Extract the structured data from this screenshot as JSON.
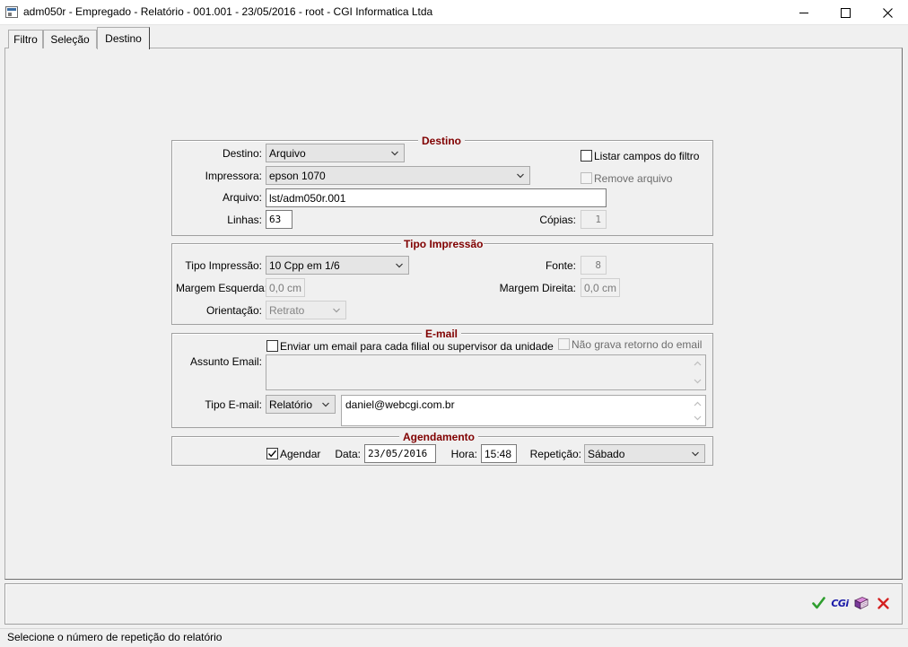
{
  "window": {
    "title": "adm050r - Empregado - Relatório - 001.001 - 23/05/2016 - root - CGI Informatica Ltda"
  },
  "tabs": [
    {
      "label": "Filtro"
    },
    {
      "label": "Seleção"
    },
    {
      "label": "Destino",
      "active": true
    }
  ],
  "destino": {
    "title": "Destino",
    "destino_label": "Destino:",
    "destino_value": "Arquivo",
    "impressora_label": "Impressora:",
    "impressora_value": "epson 1070",
    "arquivo_label": "Arquivo:",
    "arquivo_value": "lst/adm050r.001",
    "linhas_label": "Linhas:",
    "linhas_value": "63",
    "listar_label": "Listar campos do filtro",
    "listar_checked": false,
    "remove_label": "Remove arquivo",
    "remove_checked": false,
    "copias_label": "Cópias:",
    "copias_value": "1"
  },
  "tipo_impressao": {
    "title": "Tipo Impressão",
    "tipo_label": "Tipo Impressão:",
    "tipo_value": "10 Cpp em 1/6",
    "margem_esq_label": "Margem Esquerda:",
    "margem_esq_value": "0,0 cm",
    "orientacao_label": "Orientação:",
    "orientacao_value": "Retrato",
    "fonte_label": "Fonte:",
    "fonte_value": "8",
    "margem_dir_label": "Margem Direita:",
    "margem_dir_value": "0,0 cm"
  },
  "email": {
    "title": "E-mail",
    "enviar_label": "Enviar um email para cada filial ou supervisor da unidade",
    "enviar_checked": false,
    "nao_grava_label": "Não grava retorno do email",
    "nao_grava_checked": false,
    "assunto_label": "Assunto Email:",
    "assunto_value": "",
    "tipo_label": "Tipo E-mail:",
    "tipo_value": "Relatório",
    "destinatario_value": "daniel@webcgi.com.br"
  },
  "agendamento": {
    "title": "Agendamento",
    "agendar_label": "Agendar",
    "agendar_checked": true,
    "data_label": "Data:",
    "data_value": "23/05/2016",
    "hora_label": "Hora:",
    "hora_value": "15:48",
    "repeticao_label": "Repetição:",
    "repeticao_value": "Sábado"
  },
  "toolbar": {
    "confirm_icon": "checkmark-icon",
    "cgi_label": "CGi",
    "book_icon": "book-icon",
    "cancel_icon": "close-x-icon",
    "colors": {
      "confirm": "#2e9e2e",
      "cancel": "#d42020",
      "cgi": "#1a1aa8",
      "group_title": "#800000"
    }
  },
  "status": {
    "text": "Selecione o número de repetição do relatório"
  }
}
